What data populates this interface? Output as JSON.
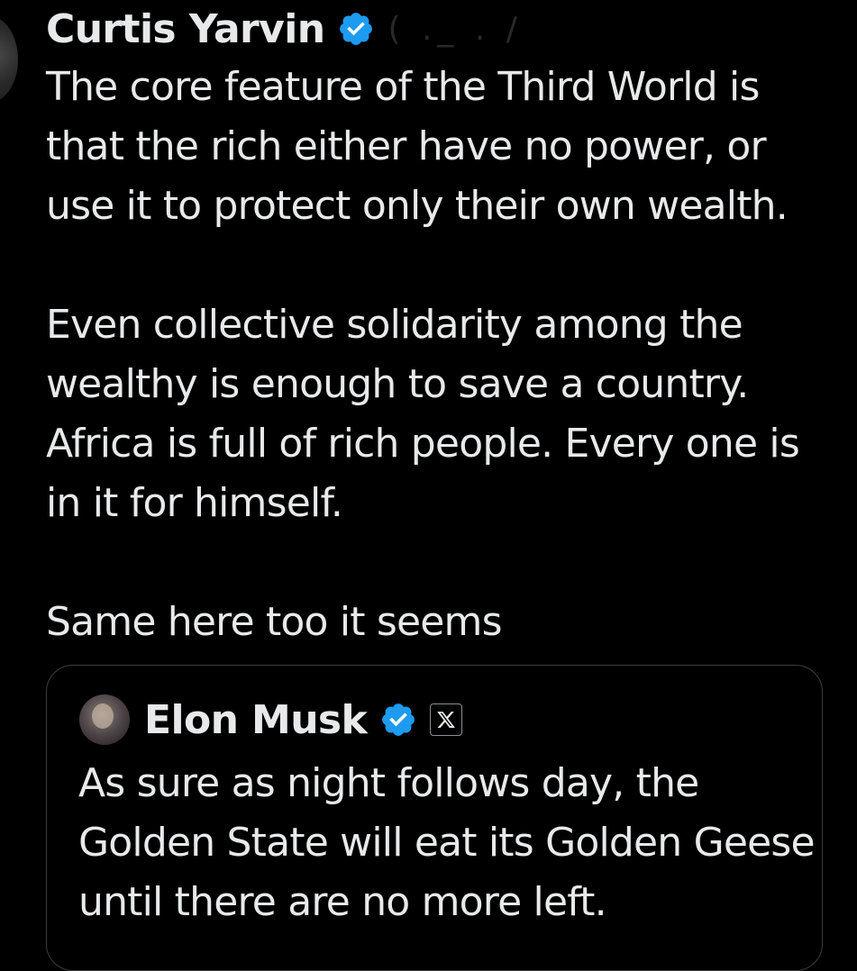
{
  "tweet": {
    "author": {
      "name": "Curtis Yarvin",
      "handle": "(  ._   .  /",
      "verified": true,
      "avatar_icon": "profile-avatar"
    },
    "text": "The core feature of the Third World is that the rich either have no power, or use it to protect only their own wealth.\n\nEven collective solidarity among the wealthy is enough to save a country. Africa is full of rich people. Every one is in it for himself.\n\nSame here too it seems"
  },
  "quoted_tweet": {
    "author": {
      "name": "Elon Musk",
      "verified": true,
      "affiliation_icon": "x-logo-icon",
      "avatar_icon": "profile-avatar"
    },
    "text": "As sure as night follows day, the Golden State will eat its Golden Geese until there are no more left."
  },
  "colors": {
    "background": "#000000",
    "text": "#e7e9ea",
    "verified_badge": "#1d9bf0",
    "card_border": "#3a3d41"
  }
}
